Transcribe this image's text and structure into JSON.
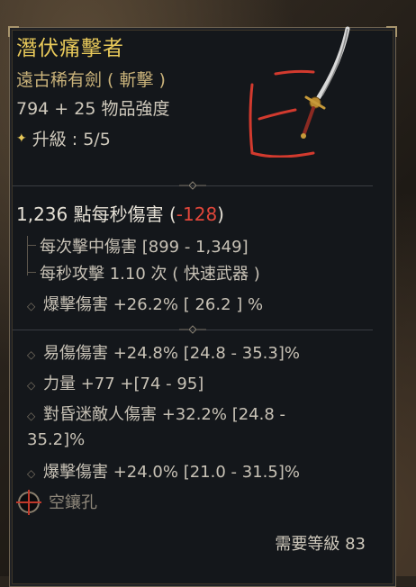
{
  "item": {
    "name": "潛伏痛擊者",
    "type": "遠古稀有劍 ( 斬擊 )",
    "power": "794 + 25 物品強度",
    "upgrade_label": "升級 : 5/5"
  },
  "stats": {
    "dps_main": "1,236 點每秒傷害 (",
    "dps_delta": "-128",
    "dps_close": ")",
    "sub": [
      "每次擊中傷害 [899 - 1,349]",
      "每秒攻擊 1.10 次 ( 快速武器 )"
    ],
    "implicit": "爆擊傷害 +26.2%   [ 26.2 ] %",
    "affixes": [
      "易傷傷害 +24.8% [24.8 - 35.3]%",
      "力量 +77 +[74 - 95]",
      "對昏迷敵人傷害 +32.2% [24.8 -",
      "35.2]%",
      "爆擊傷害 +24.0% [21.0 - 31.5]%"
    ]
  },
  "socket_label": "空鑲孔",
  "requirement": "需要等級 83",
  "colors": {
    "title": "#e8c95a",
    "subtitle": "#c9b27a",
    "negative": "#e0463a"
  },
  "icons": [
    "sword-icon",
    "diamond-icon",
    "socket-icon"
  ]
}
